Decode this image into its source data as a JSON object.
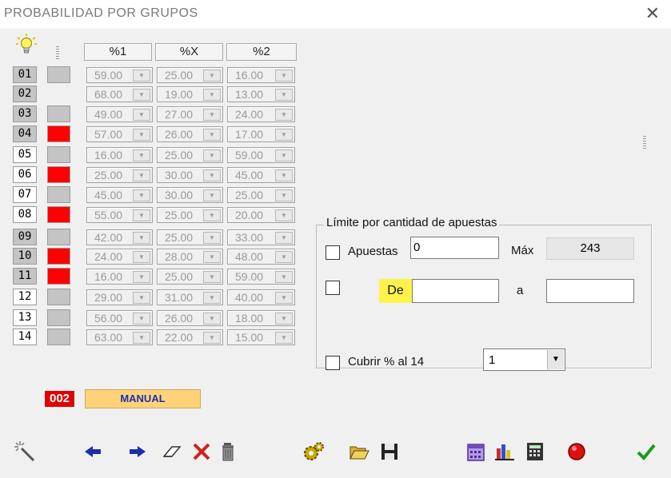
{
  "window": {
    "title": "PROBABILIDAD POR GRUPOS",
    "close_glyph": "✕"
  },
  "columns": [
    "%1",
    "%X",
    "%2"
  ],
  "rows": [
    {
      "num": "01",
      "num_style": "gray",
      "flag": "gray",
      "v": [
        "59.00",
        "25.00",
        "16.00"
      ]
    },
    {
      "num": "02",
      "num_style": "gray",
      "flag": "none",
      "v": [
        "68.00",
        "19.00",
        "13.00"
      ]
    },
    {
      "num": "03",
      "num_style": "gray",
      "flag": "gray",
      "v": [
        "49.00",
        "27.00",
        "24.00"
      ]
    },
    {
      "num": "04",
      "num_style": "gray",
      "flag": "red",
      "v": [
        "57.00",
        "26.00",
        "17.00"
      ]
    },
    {
      "num": "05",
      "num_style": "white",
      "flag": "gray",
      "v": [
        "16.00",
        "25.00",
        "59.00"
      ]
    },
    {
      "num": "06",
      "num_style": "white",
      "flag": "red",
      "v": [
        "25.00",
        "30.00",
        "45.00"
      ]
    },
    {
      "num": "07",
      "num_style": "white",
      "flag": "gray",
      "v": [
        "45.00",
        "30.00",
        "25.00"
      ]
    },
    {
      "num": "08",
      "num_style": "white",
      "flag": "red",
      "v": [
        "55.00",
        "25.00",
        "20.00"
      ]
    },
    {
      "num": "09",
      "num_style": "gray",
      "flag": "gray",
      "v": [
        "42.00",
        "25.00",
        "33.00"
      ]
    },
    {
      "num": "10",
      "num_style": "gray",
      "flag": "red",
      "v": [
        "24.00",
        "28.00",
        "48.00"
      ]
    },
    {
      "num": "11",
      "num_style": "gray",
      "flag": "red",
      "v": [
        "16.00",
        "25.00",
        "59.00"
      ]
    },
    {
      "num": "12",
      "num_style": "white",
      "flag": "gray",
      "v": [
        "29.00",
        "31.00",
        "40.00"
      ]
    },
    {
      "num": "13",
      "num_style": "white",
      "flag": "gray",
      "v": [
        "56.00",
        "26.00",
        "18.00"
      ]
    },
    {
      "num": "14",
      "num_style": "white",
      "flag": "gray",
      "v": [
        "63.00",
        "22.00",
        "15.00"
      ]
    }
  ],
  "panel": {
    "legend": "Límite por cantidad de apuestas",
    "apuestas_label": "Apuestas",
    "apuestas_value": "0",
    "max_label": "Máx",
    "max_value": "243",
    "de_label": "De",
    "de_value": "",
    "a_label": "a",
    "a_value": "",
    "cubrir_label": "Cubrir % al 14",
    "cubrir_value": "1"
  },
  "status": {
    "counter": "002",
    "mode": "MANUAL"
  },
  "colors": {
    "red": "#ff0000",
    "gray_flag": "#c4c4c4",
    "counter_bg": "#e00000",
    "mode_bg": "#ffd27a",
    "mode_text": "#1c2fb0",
    "highlight": "#fff24a"
  },
  "toolbar": [
    {
      "icon": "magic-wand-icon"
    },
    {
      "icon": "arrow-left-icon"
    },
    {
      "icon": "arrow-right-icon"
    },
    {
      "icon": "eraser-icon"
    },
    {
      "icon": "delete-x-icon"
    },
    {
      "icon": "trash-can-icon"
    },
    {
      "icon": "gears-icon"
    },
    {
      "icon": "open-folder-icon"
    },
    {
      "icon": "save-disk-icon"
    },
    {
      "icon": "calendar-icon"
    },
    {
      "icon": "bar-chart-icon"
    },
    {
      "icon": "calculator-icon"
    },
    {
      "icon": "record-button-icon"
    },
    {
      "icon": "checkmark-icon"
    }
  ]
}
